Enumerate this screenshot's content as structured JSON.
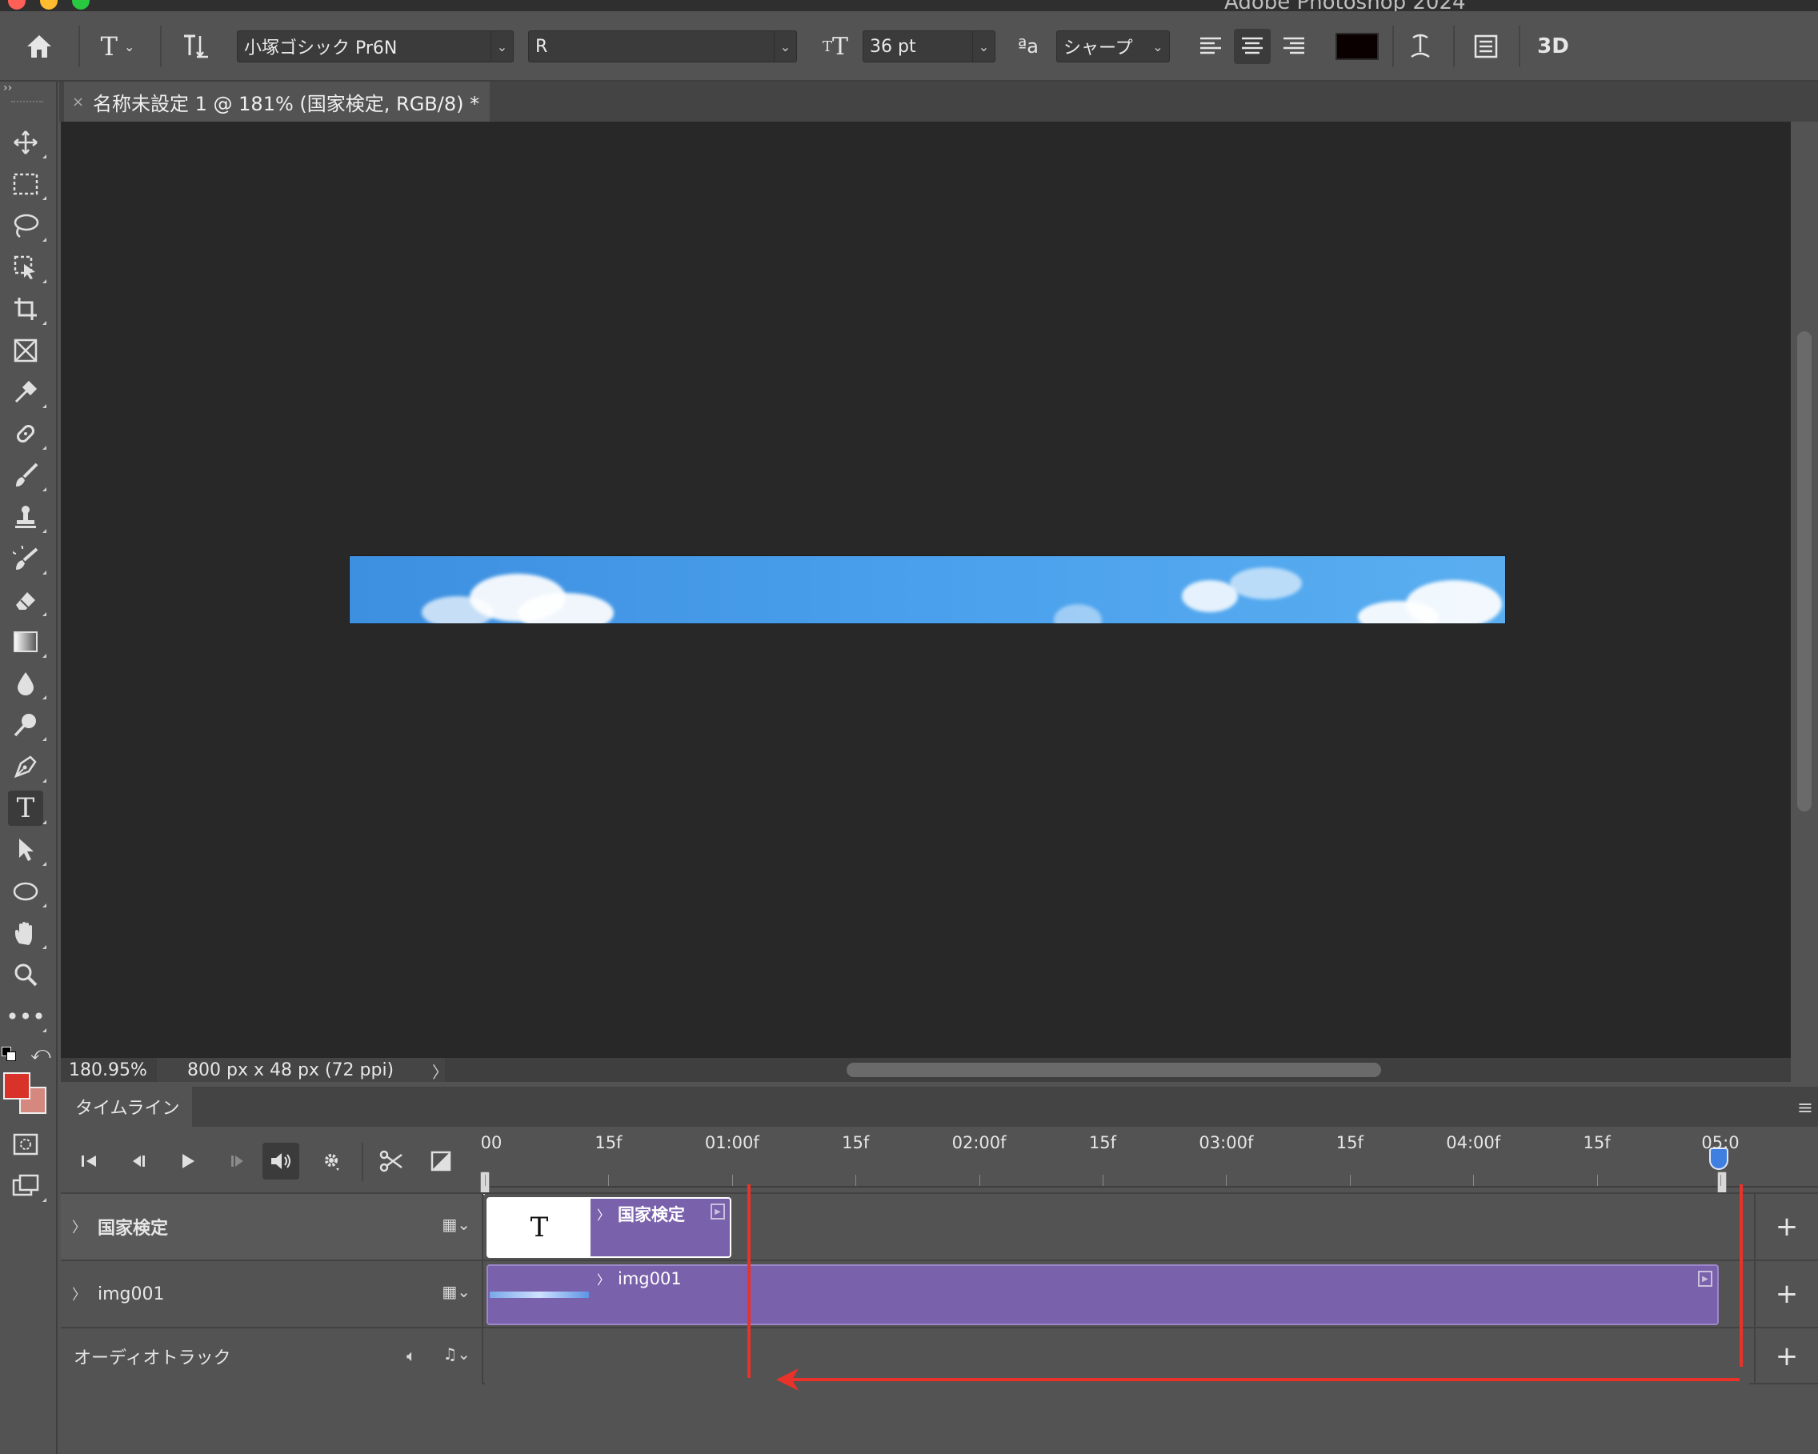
{
  "app": {
    "title": "Adobe Photoshop 2024"
  },
  "window": {
    "traffic_colors": [
      "#fe5f57",
      "#febc2e",
      "#28c840"
    ]
  },
  "options_bar": {
    "tool_letter": "T",
    "font_family": "小塚ゴシック Pr6N",
    "font_style": "R",
    "font_size": "36 pt",
    "antialias_icon_text": "ªa",
    "antialias": "シャープ",
    "text_color": "#0a0000",
    "threed_label": "3D"
  },
  "document": {
    "tab_title": "名称未設定 1 @ 181% (国家検定, RGB/8) *",
    "zoom": "180.95%",
    "info": "800 px x 48 px (72 ppi)"
  },
  "toolbar": {
    "active_tool": "type-tool",
    "foreground_color": "#d93229",
    "background_color": "#d48880"
  },
  "timeline": {
    "tab_label": "タイムライン",
    "ruler_labels": [
      "00",
      "15f",
      "01:00f",
      "15f",
      "02:00f",
      "15f",
      "03:00f",
      "15f",
      "04:00f",
      "15f",
      "05:0"
    ],
    "tracks": [
      {
        "name": "国家検定",
        "clip_label": "国家検定",
        "thumb": "T"
      },
      {
        "name": "img001",
        "clip_label": "img001"
      }
    ],
    "audio_track": "オーディオトラック"
  }
}
